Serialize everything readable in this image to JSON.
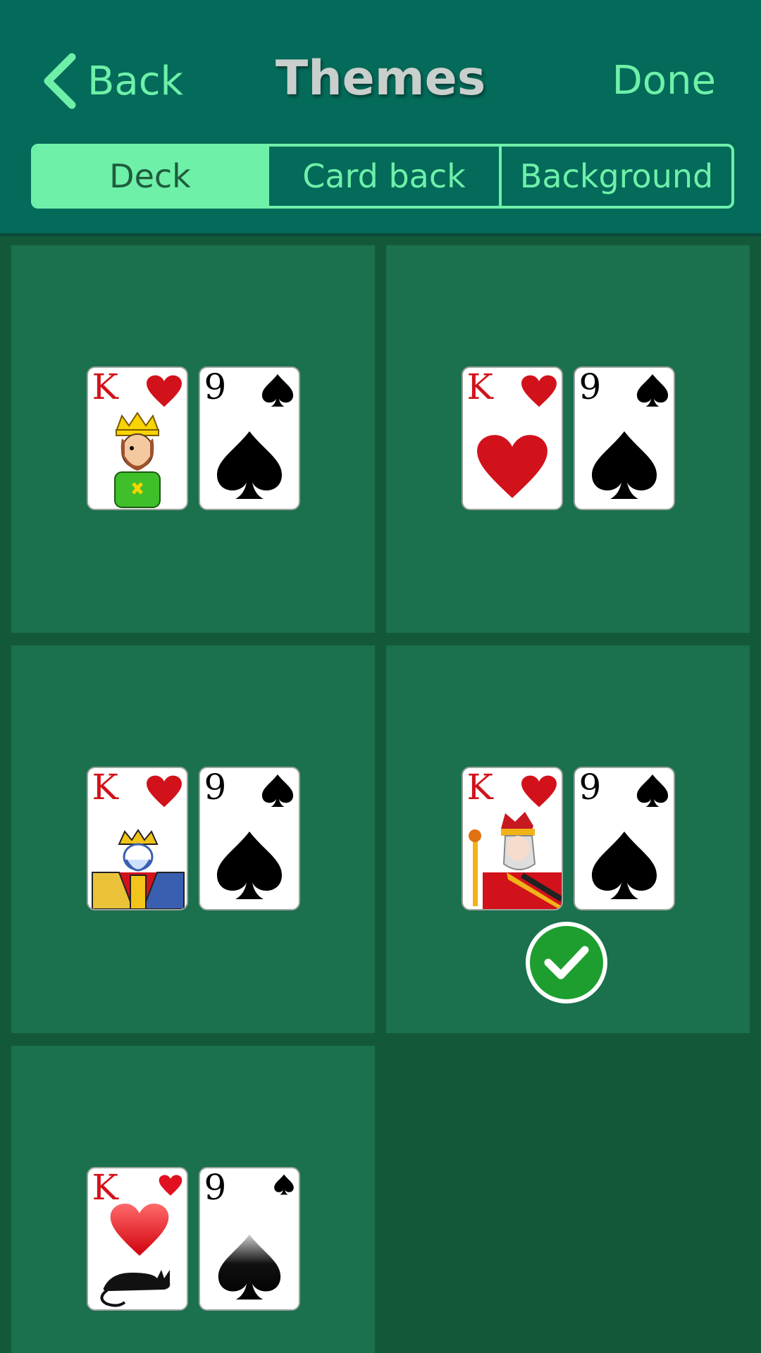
{
  "header": {
    "back_label": "Back",
    "title": "Themes",
    "done_label": "Done"
  },
  "tabs": [
    {
      "label": "Deck",
      "active": true
    },
    {
      "label": "Card back",
      "active": false
    },
    {
      "label": "Background",
      "active": false
    }
  ],
  "decks": [
    {
      "style": "cartoon",
      "king_rank": "K",
      "nine_rank": "9",
      "selected": false
    },
    {
      "style": "simple",
      "king_rank": "K",
      "nine_rank": "9",
      "selected": false
    },
    {
      "style": "classic",
      "king_rank": "K",
      "nine_rank": "9",
      "selected": false
    },
    {
      "style": "modern",
      "king_rank": "K",
      "nine_rank": "9",
      "selected": true
    },
    {
      "style": "cat",
      "king_rank": "K",
      "nine_rank": "9",
      "selected": false
    }
  ],
  "colors": {
    "header_bg": "#046a59",
    "accent": "#6ef0a9",
    "tile_bg": "#1b704d",
    "page_bg": "#14583a",
    "check_green": "#1e9e2e"
  }
}
